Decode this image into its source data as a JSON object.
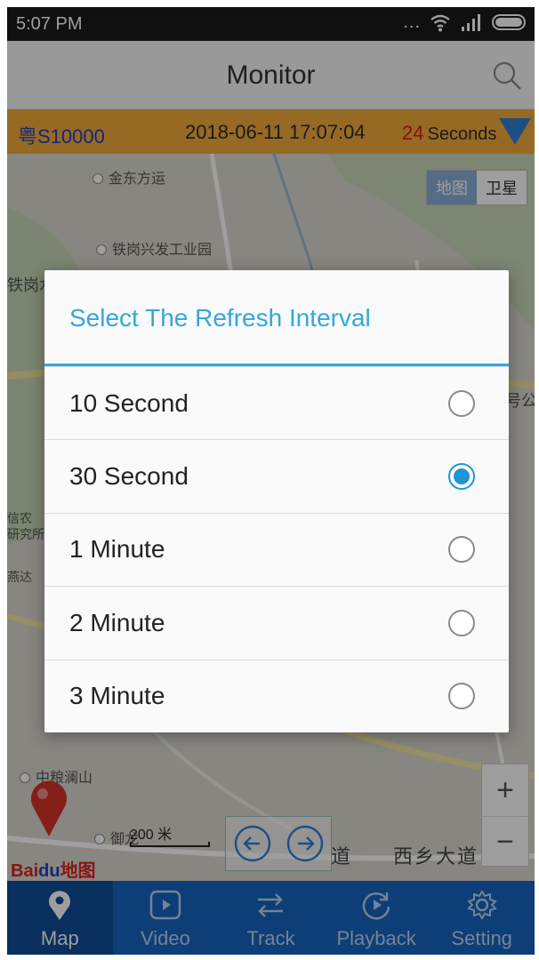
{
  "status_bar": {
    "time": "5:07 PM",
    "dots": "..."
  },
  "header": {
    "title": "Monitor",
    "search_icon": "search-icon"
  },
  "info_bar": {
    "plate": "粤S10000",
    "datetime": "2018-06-11 17:07:04",
    "countdown": "24",
    "countdown_unit": "Seconds"
  },
  "map": {
    "map_type_options": [
      "地图",
      "卫星"
    ],
    "selected_map_type": "地图",
    "poi_labels": [
      "金东方运",
      "铁岗兴发工业园",
      "中粮澜山",
      "御龙",
      "铁岗水库",
      "号公",
      "信农",
      "研究所",
      "燕达"
    ],
    "scale_label": "200 米",
    "road_labels": [
      "道",
      "西乡大道"
    ],
    "logo_text_1": "Bai",
    "logo_text_2": "du",
    "logo_text_3": "地图",
    "zoom_in": "+",
    "zoom_out": "−"
  },
  "dialog": {
    "title": "Select The Refresh Interval",
    "options": [
      {
        "label": "10 Second",
        "checked": false
      },
      {
        "label": "30 Second",
        "checked": true
      },
      {
        "label": "1 Minute",
        "checked": false
      },
      {
        "label": "2 Minute",
        "checked": false
      },
      {
        "label": "3 Minute",
        "checked": false
      }
    ]
  },
  "bottom_nav": [
    {
      "label": "Map",
      "icon": "map-pin-icon",
      "active": true
    },
    {
      "label": "Video",
      "icon": "play-icon",
      "active": false
    },
    {
      "label": "Track",
      "icon": "track-arrows-icon",
      "active": false
    },
    {
      "label": "Playback",
      "icon": "playback-icon",
      "active": false
    },
    {
      "label": "Setting",
      "icon": "gear-icon",
      "active": false
    }
  ],
  "colors": {
    "accent": "#33a8d9",
    "info_bar": "#f2ab3c",
    "nav": "#1565c0",
    "radio_checked": "#1f95d6"
  }
}
